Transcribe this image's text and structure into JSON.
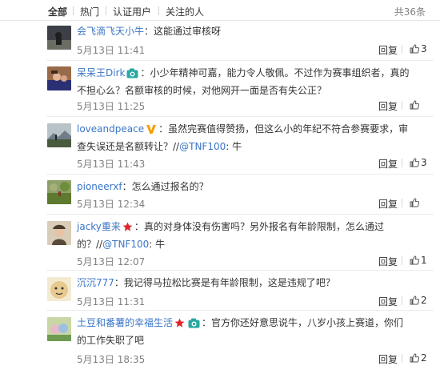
{
  "tabs": [
    {
      "label": "全部"
    },
    {
      "label": "热门"
    },
    {
      "label": "认证用户"
    },
    {
      "label": "关注的人"
    }
  ],
  "total": "共36条",
  "reply_label": "回复",
  "comments": [
    {
      "user": "会飞滴飞天小牛",
      "sep": "：",
      "text": "这能通过审核呀",
      "time": "5月13日 11:41",
      "likes": "3"
    },
    {
      "user": "呆呆王Dirk",
      "sep": "：",
      "text": "小少年精神可嘉，能力令人敬佩。不过作为赛事组织者，真的不担心么？名额审核的时候，对他网开一面是否有失公正？",
      "time": "5月13日 11:25",
      "likes": ""
    },
    {
      "user": "loveandpeace",
      "sep": "：",
      "text": "虽然完赛值得赞扬，但这么小的年纪不符合参赛要求，审查失误还是名额转让？",
      "text2": "//",
      "mention": "@TNF100",
      "text3": ": 牛",
      "time": "5月13日 11:43",
      "likes": "3"
    },
    {
      "user": "pioneerxf",
      "sep": "：",
      "text": "怎么通过报名的？",
      "time": "5月13日 12:34",
      "likes": ""
    },
    {
      "user": "jacky重来",
      "sep": "：",
      "text": "真的对身体没有伤害吗？另外报名有年龄限制，怎么通过的？",
      "text2": "//",
      "mention": "@TNF100",
      "text3": ": 牛",
      "time": "5月13日 12:07",
      "likes": "1"
    },
    {
      "user": "沉沉777",
      "sep": "：",
      "text": "我记得马拉松比赛是有年龄限制，这是违规了吧？",
      "time": "5月13日 11:31",
      "likes": "2"
    },
    {
      "user": "土豆和番薯的幸福生活",
      "sep": "：",
      "text": "官方你还好意思说牛，八岁小孩上赛道，你们的工作失职了吧",
      "time": "5月13日 18:35",
      "likes": "2"
    }
  ],
  "icons": {
    "like": "thumbs-up-icon",
    "camera_badge": "camera-badge-icon",
    "star_badge": "star-badge-icon",
    "verified_badge": "verified-v-icon"
  },
  "colors": {
    "link": "#3b76c7",
    "time": "#808080",
    "star": "#e0232a",
    "camera": "#2aa7a1",
    "vip": "#f5a000"
  }
}
